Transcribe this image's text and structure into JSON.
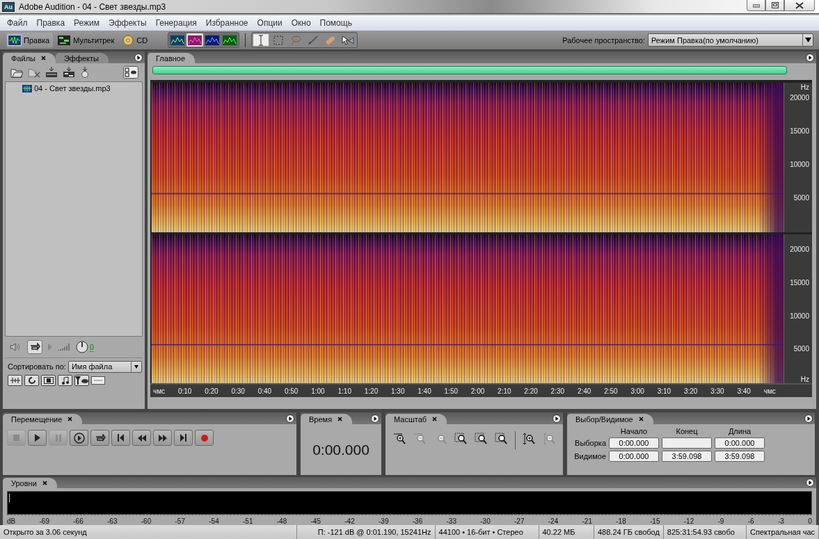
{
  "window": {
    "app_badge": "Au",
    "title": "Adobe Audition - 04 - Свет звезды.mp3"
  },
  "menu": [
    "Файл",
    "Правка",
    "Режим",
    "Эффекты",
    "Генерация",
    "Избранное",
    "Опции",
    "Окно",
    "Помощь"
  ],
  "toolbar": {
    "modes": [
      {
        "kind": "edit",
        "label": "Правка",
        "selected": true
      },
      {
        "kind": "multitrack",
        "label": "Мультитрек",
        "selected": false
      },
      {
        "kind": "cd",
        "label": "CD",
        "selected": false
      }
    ],
    "views": [
      {
        "kind": "waveform",
        "selected": false
      },
      {
        "kind": "spectral",
        "selected": true
      },
      {
        "kind": "pan",
        "selected": false
      },
      {
        "kind": "phase",
        "selected": false
      }
    ],
    "tools": [
      {
        "kind": "ibeam",
        "selected": true
      },
      {
        "kind": "marquee",
        "selected": false
      },
      {
        "kind": "lasso",
        "selected": false
      },
      {
        "kind": "brush",
        "selected": false
      },
      {
        "kind": "bandage",
        "selected": false
      },
      {
        "kind": "pointer",
        "selected": false
      }
    ],
    "workspace": {
      "label": "Рабочее пространство:",
      "value": "Режим Правка(по умолчанию)"
    }
  },
  "files_panel": {
    "tabs": [
      {
        "label": "Файлы",
        "selected": true,
        "closable": true
      },
      {
        "label": "Эффекты",
        "selected": false,
        "closable": false
      }
    ],
    "files": [
      {
        "name": "04 - Свет звезды.mp3"
      }
    ],
    "volume": "0",
    "sort": {
      "label": "Сортировать по:",
      "value": "Имя файла"
    }
  },
  "editor": {
    "tab": "Главное",
    "channels": [
      {
        "unit_top": "Hz",
        "ticks": [
          "20000",
          "15000",
          "10000",
          "5000"
        ]
      },
      {
        "unit_bottom": "Hz",
        "ticks": [
          "20000",
          "15000",
          "10000",
          "5000"
        ]
      }
    ],
    "ruler": [
      "чмс",
      "0:10",
      "0:20",
      "0:30",
      "0:40",
      "0:50",
      "1:00",
      "1:10",
      "1:20",
      "1:30",
      "1:40",
      "1:50",
      "2:00",
      "2:10",
      "2:20",
      "2:30",
      "2:40",
      "2:50",
      "3:00",
      "3:10",
      "3:20",
      "3:30",
      "3:40",
      "чмс"
    ]
  },
  "transport": {
    "tab": "Перемещение",
    "buttons": [
      {
        "kind": "stop",
        "disabled": true
      },
      {
        "kind": "play",
        "disabled": false
      },
      {
        "kind": "pause",
        "disabled": true
      },
      {
        "kind": "play-cursor",
        "disabled": false
      },
      {
        "kind": "loop",
        "disabled": false
      },
      {
        "kind": "to-start",
        "disabled": false
      },
      {
        "kind": "rewind",
        "disabled": false
      },
      {
        "kind": "forward",
        "disabled": false
      },
      {
        "kind": "to-end",
        "disabled": false
      },
      {
        "kind": "record",
        "disabled": false
      }
    ]
  },
  "time": {
    "tab": "Время",
    "value": "0:00.000"
  },
  "zoom": {
    "tab": "Масштаб",
    "buttons": [
      {
        "kind": "in-h",
        "disabled": false
      },
      {
        "kind": "out-h",
        "disabled": true
      },
      {
        "kind": "out-full",
        "disabled": true
      },
      {
        "kind": "sel",
        "disabled": false
      },
      {
        "kind": "left",
        "disabled": false
      },
      {
        "kind": "right",
        "disabled": false
      },
      {
        "kind": "in-v",
        "disabled": false
      },
      {
        "kind": "out-v",
        "disabled": true
      }
    ]
  },
  "selection": {
    "tab": "Выбор/Видимое",
    "headers": [
      "Начало",
      "Конец",
      "Длина"
    ],
    "rows": [
      {
        "label": "Выборка",
        "start": "0:00.000",
        "length": "0:00.000"
      },
      {
        "label": "Видимое",
        "start": "0:00.000",
        "end": "3:59.098",
        "length": "3:59.098"
      }
    ]
  },
  "levels": {
    "tab": "Уровни",
    "scale": [
      "dB",
      "-69",
      "-66",
      "-63",
      "-60",
      "-57",
      "-54",
      "-51",
      "-48",
      "-45",
      "-42",
      "-39",
      "-36",
      "-33",
      "-30",
      "-27",
      "-24",
      "-21",
      "-18",
      "-15",
      "-12",
      "-9",
      "-6",
      "-3",
      "0"
    ]
  },
  "status_bar": [
    "Открыто за 3.06 секунд",
    "П: -121 dB @  0:01.190, 15241Hz",
    "44100 • 16-бит • Стерео",
    "40.22 МБ",
    "488.24 ГБ свобод",
    "825:31:54.93 свобо",
    "Спектральная час"
  ]
}
